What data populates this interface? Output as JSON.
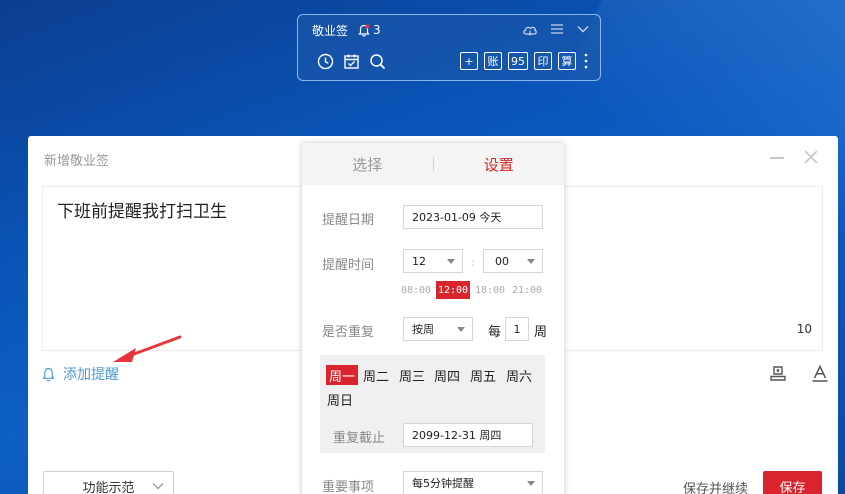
{
  "toolbar": {
    "title": "敬业签",
    "reminder_count": "3",
    "box_buttons": [
      "+",
      "账",
      "95",
      "印",
      "算"
    ]
  },
  "dialog": {
    "title": "新增敬业签",
    "note_text": "下班前提醒我打扫卫生",
    "char_count": "10",
    "add_reminder_label": "添加提醒",
    "demo_select_value": "功能示范",
    "save_continue_label": "保存并继续",
    "save_label": "保存"
  },
  "popup": {
    "tabs": [
      "选择",
      "设置"
    ],
    "active_tab": "设置",
    "date_label": "提醒日期",
    "date_value": "2023-01-09 今天",
    "time_label": "提醒时间",
    "hour_value": "12",
    "minute_value": "00",
    "time_separator": ":",
    "presets": [
      "08:00",
      "12:00",
      "18:00",
      "21:00"
    ],
    "selected_preset": "12:00",
    "repeat_label": "是否重复",
    "repeat_value": "按周",
    "every_label": "每",
    "every_value": "1",
    "unit_label": "周",
    "weekdays": [
      "周一",
      "周二",
      "周三",
      "周四",
      "周五",
      "周六",
      "周日"
    ],
    "selected_weekday": "周一",
    "repeat_end_label": "重复截止",
    "repeat_end_value": "2099-12-31 周四",
    "important_label": "重要事项",
    "important_value": "每5分钟提醒"
  },
  "colors": {
    "accent_red": "#d9232d",
    "link_blue": "#4f99d6",
    "desktop_blue": "#0a55b8"
  }
}
